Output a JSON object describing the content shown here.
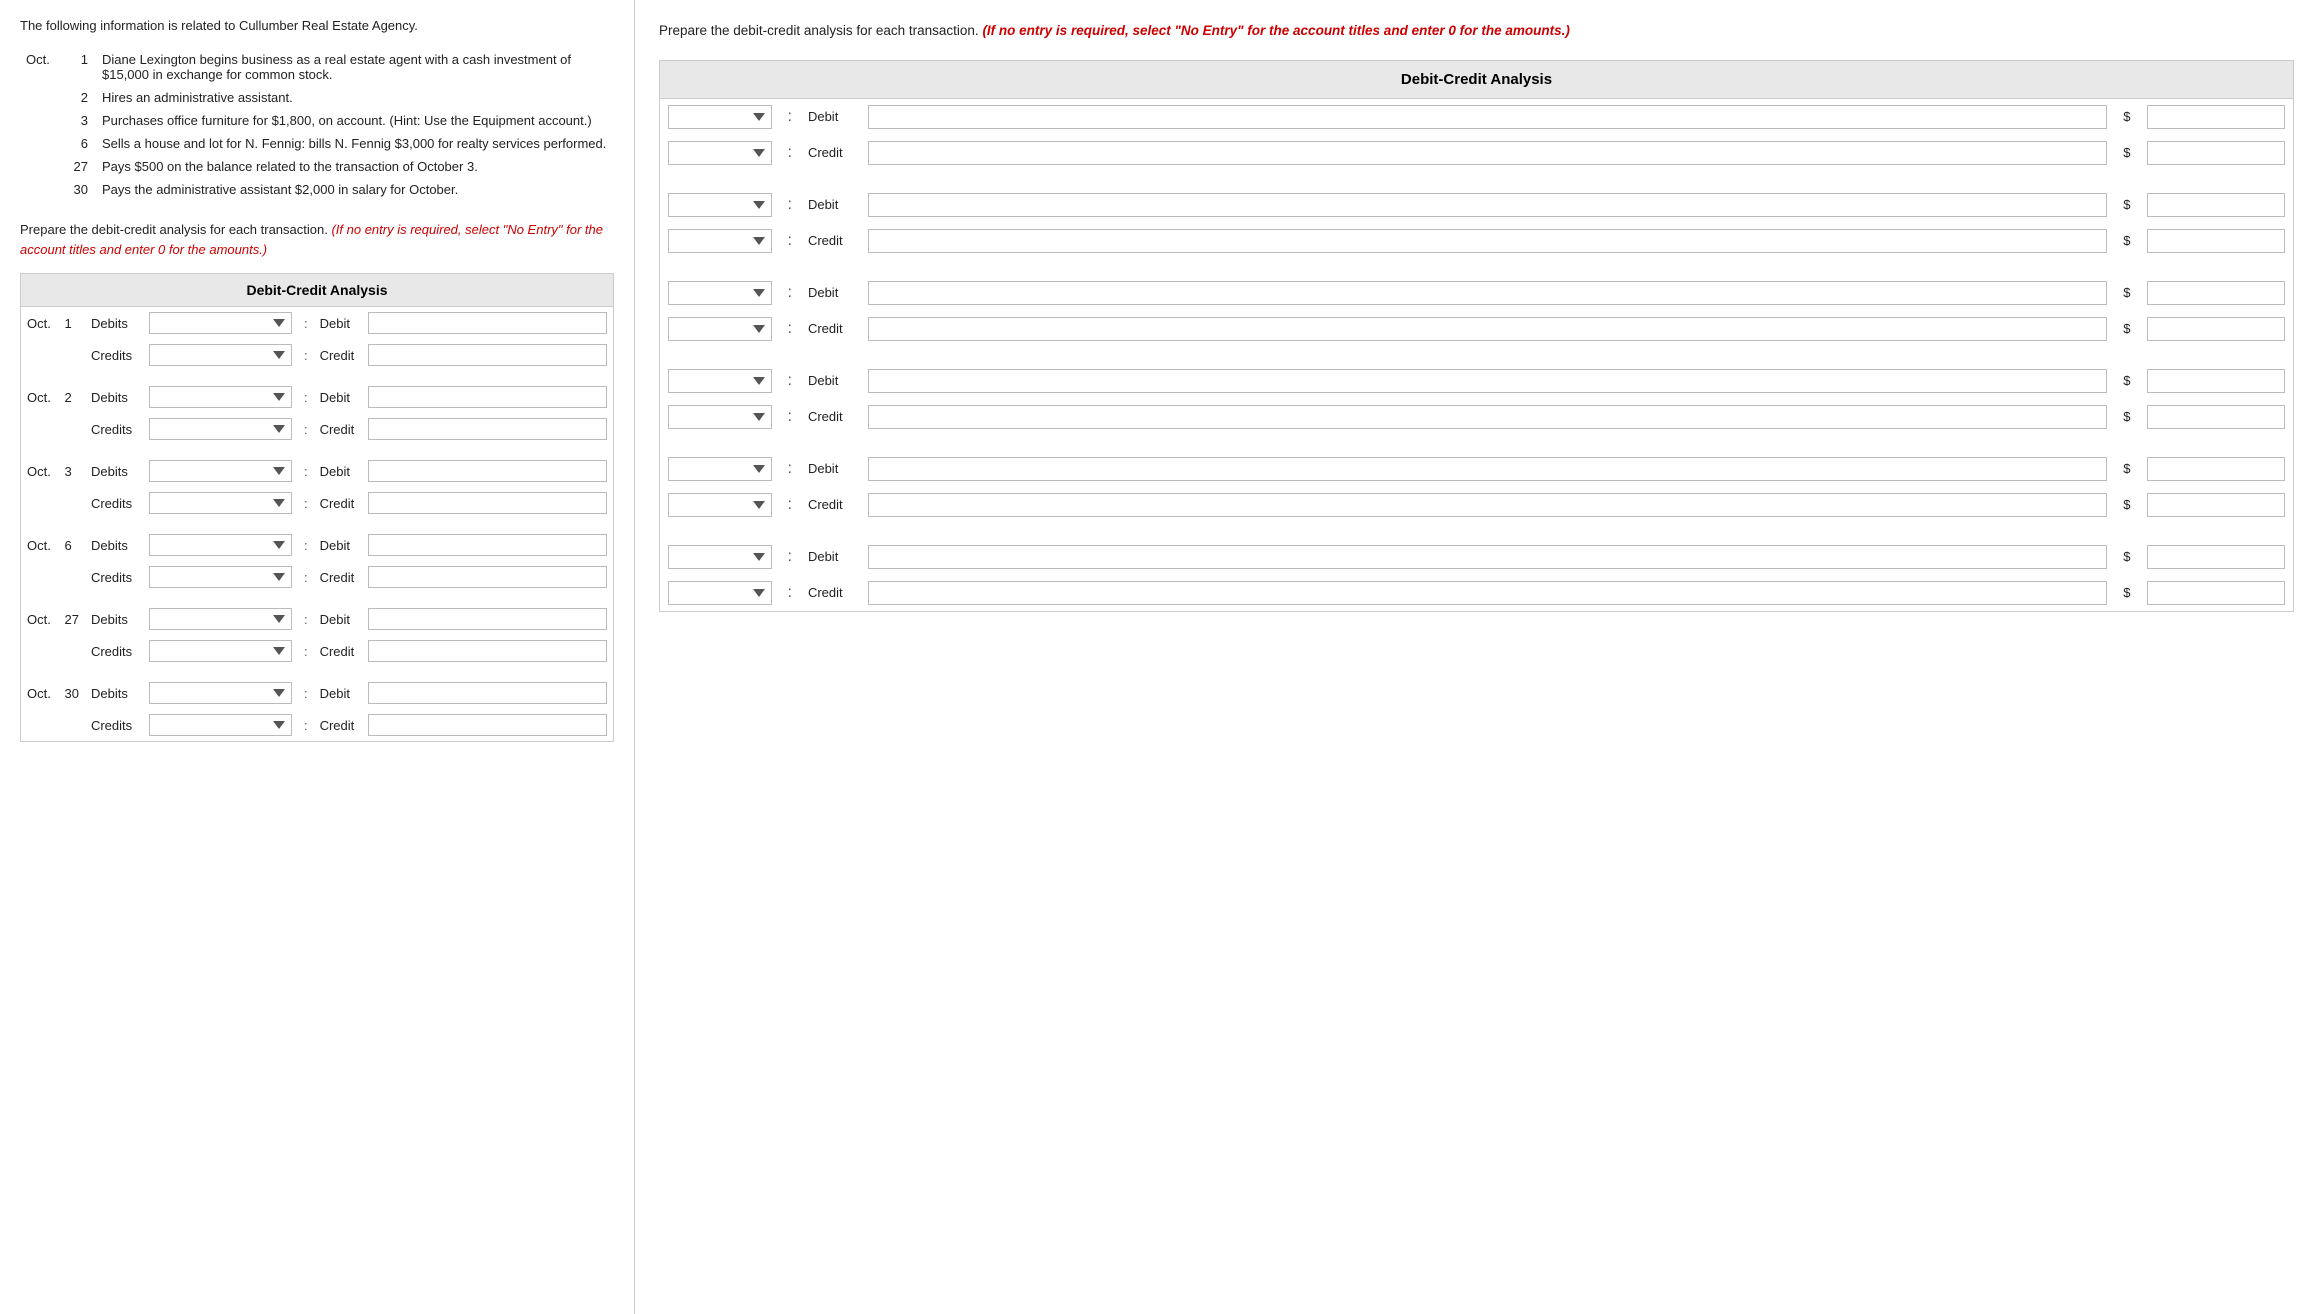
{
  "left": {
    "intro": "The following information is related to Cullumber Real Estate Agency.",
    "transactions": [
      {
        "oct": "Oct.",
        "num": "1",
        "desc": "Diane Lexington begins business as a real estate agent with a cash investment of $15,000 in exchange for common stock."
      },
      {
        "oct": "",
        "num": "2",
        "desc": "Hires an administrative assistant."
      },
      {
        "oct": "",
        "num": "3",
        "desc": "Purchases office furniture for $1,800, on account. (Hint: Use the Equipment account.)"
      },
      {
        "oct": "",
        "num": "6",
        "desc": "Sells a house and lot for N. Fennig: bills N. Fennig $3,000 for realty services performed."
      },
      {
        "oct": "",
        "num": "27",
        "desc": "Pays $500 on the balance related to the transaction of October 3."
      },
      {
        "oct": "",
        "num": "30",
        "desc": "Pays the administrative assistant $2,000 in salary for October."
      }
    ],
    "instruction_prefix": "Prepare the debit-credit analysis for each transaction.",
    "instruction_italic": "(If no entry is required, select \"No Entry\" for the account titles and enter 0 for the amounts.)",
    "section_header": "Debit-Credit Analysis",
    "entries": [
      {
        "oct": "Oct.",
        "num": "1",
        "debits_label": "Debits",
        "credits_label": "Credits"
      },
      {
        "oct": "Oct.",
        "num": "2",
        "debits_label": "Debits",
        "credits_label": "Credits"
      },
      {
        "oct": "Oct.",
        "num": "3",
        "debits_label": "Debits",
        "credits_label": "Credits"
      },
      {
        "oct": "Oct.",
        "num": "6",
        "debits_label": "Debits",
        "credits_label": "Credits"
      },
      {
        "oct": "Oct.",
        "num": "27",
        "debits_label": "Debits",
        "credits_label": "Credits"
      },
      {
        "oct": "Oct.",
        "num": "30",
        "debits_label": "Debits",
        "credits_label": "Credits"
      }
    ]
  },
  "right": {
    "instruction_prefix": "Prepare the debit-credit analysis for each transaction.",
    "instruction_italic": "(If no entry is required, select \"No Entry\" for the account titles and enter 0 for the amounts.)",
    "section_header": "Debit-Credit Analysis",
    "rows": [
      {
        "dc": "Debit",
        "dollar": "$"
      },
      {
        "dc": "Credit",
        "dollar": "$"
      },
      {
        "dc": "Debit",
        "dollar": "$"
      },
      {
        "dc": "Credit",
        "dollar": "$"
      },
      {
        "dc": "Debit",
        "dollar": "$"
      },
      {
        "dc": "Credit",
        "dollar": "$"
      },
      {
        "dc": "Debit",
        "dollar": "$"
      },
      {
        "dc": "Credit",
        "dollar": "$"
      },
      {
        "dc": "Debit",
        "dollar": "$"
      },
      {
        "dc": "Credit",
        "dollar": "$"
      },
      {
        "dc": "Debit",
        "dollar": "$"
      },
      {
        "dc": "Credit",
        "dollar": "$"
      }
    ],
    "colon": ":",
    "debit_label": "Debit",
    "credit_label": "Credit"
  }
}
